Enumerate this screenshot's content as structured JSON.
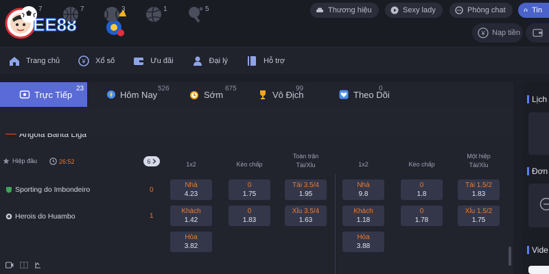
{
  "header": {
    "logo_text": "EE88",
    "top_links": [
      {
        "label": "Thương hiệu",
        "icon": "car-icon"
      },
      {
        "label": "Sexy lady",
        "icon": "play-icon"
      },
      {
        "label": "Phòng chat",
        "icon": "chat-icon"
      },
      {
        "label": "Tin",
        "icon": "headset-icon"
      }
    ],
    "deposit_label": "Nạp tiền"
  },
  "nav": [
    {
      "label": "Trang chủ",
      "icon": "home-icon"
    },
    {
      "label": "Xổ số",
      "icon": "lottery-icon"
    },
    {
      "label": "Ưu đãi",
      "icon": "wallet-icon"
    },
    {
      "label": "Đại lý",
      "icon": "agent-icon"
    },
    {
      "label": "Hỗ trợ",
      "icon": "book-icon"
    }
  ],
  "tabs": [
    {
      "label": "Trực Tiếp",
      "count": "23",
      "icon": "live-icon"
    },
    {
      "label": "Hôm Nay",
      "count": "526",
      "icon": "compass-icon"
    },
    {
      "label": "Sớm",
      "count": "675",
      "icon": "alarm-icon"
    },
    {
      "label": "Vô Địch",
      "count": "99",
      "icon": "trophy-icon"
    },
    {
      "label": "Theo Dõi",
      "count": "0",
      "icon": "heart-icon"
    }
  ],
  "sports": [
    {
      "name": "soccer-icon",
      "count": "7"
    },
    {
      "name": "basketball-icon",
      "count": "7"
    },
    {
      "name": "tennis-icon",
      "count": "3"
    },
    {
      "name": "volleyball-icon",
      "count": "1"
    },
    {
      "name": "table-tennis-icon",
      "count": "5"
    }
  ],
  "league": "Angola Banta Liga",
  "match_header": {
    "period": "Hiệp đầu",
    "time": "26:52",
    "more": "6",
    "full_time_label": "Toàn trận",
    "first_half_label": "Một hiệp",
    "col_1x2": "1x2",
    "col_handicap": "Kèo chấp",
    "col_ou": "Tài/Xỉu"
  },
  "teams": [
    {
      "name": "Sporting do Imbondeiro",
      "score": "0"
    },
    {
      "name": "Herois do Huambo",
      "score": "1"
    }
  ],
  "odds": {
    "ft_1x2": [
      {
        "label": "Nhà",
        "value": "4.23"
      },
      {
        "label": "Khách",
        "value": "1.42"
      },
      {
        "label": "Hòa",
        "value": "3.82"
      }
    ],
    "ft_hdp": [
      {
        "label": "0",
        "value": "1.75"
      },
      {
        "label": "0",
        "value": "1.83"
      }
    ],
    "ft_ou": [
      {
        "label": "Tài 3.5/4",
        "value": "1.95"
      },
      {
        "label": "Xỉu 3.5/4",
        "value": "1.63"
      }
    ],
    "h1_1x2": [
      {
        "label": "Nhà",
        "value": "9.8"
      },
      {
        "label": "Khách",
        "value": "1.18"
      },
      {
        "label": "Hòa",
        "value": "3.88"
      }
    ],
    "h1_hdp": [
      {
        "label": "0",
        "value": "1.8"
      },
      {
        "label": "0",
        "value": "1.78"
      }
    ],
    "h1_ou": [
      {
        "label": "Tài 1.5/2",
        "value": "1.83"
      },
      {
        "label": "Xỉu 1.5/2",
        "value": "1.75"
      }
    ]
  },
  "right_panel": {
    "titles": [
      "Lịch",
      "Đơn",
      "Vide"
    ]
  },
  "colors": {
    "accent": "#5a6bd8",
    "odd_label": "#f07a2a",
    "background": "#1d1f28"
  }
}
